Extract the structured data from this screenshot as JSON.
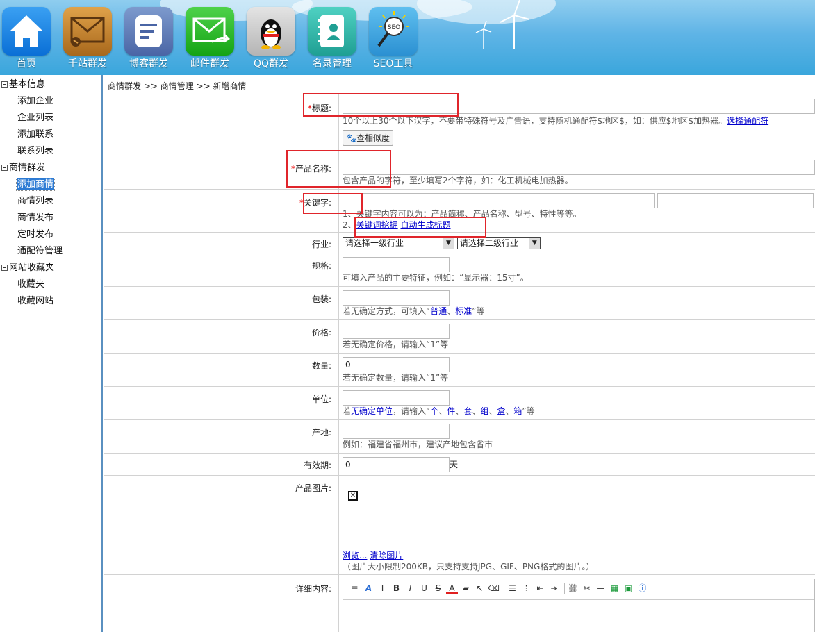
{
  "top_nav": [
    {
      "label": "首页",
      "icon": "home-icon"
    },
    {
      "label": "千站群发",
      "icon": "envelope-stack-icon"
    },
    {
      "label": "博客群发",
      "icon": "blog-doc-icon"
    },
    {
      "label": "邮件群发",
      "icon": "mail-send-icon"
    },
    {
      "label": "QQ群发",
      "icon": "qq-penguin-icon"
    },
    {
      "label": "名录管理",
      "icon": "contact-book-icon"
    },
    {
      "label": "SEO工具",
      "icon": "seo-magnifier-icon"
    }
  ],
  "sidebar": {
    "groups": [
      {
        "title": "基本信息",
        "items": [
          "添加企业",
          "企业列表",
          "添加联系",
          "联系列表"
        ]
      },
      {
        "title": "商情群发",
        "items": [
          "添加商情",
          "商情列表",
          "商情发布",
          "定时发布",
          "通配符管理"
        ]
      },
      {
        "title": "网站收藏夹",
        "items": [
          "收藏夹",
          "收藏网站"
        ]
      }
    ],
    "active": "添加商情"
  },
  "breadcrumb": "商情群发 >> 商情管理 >> 新增商情",
  "form": {
    "title": {
      "star": "*",
      "label": "标题:",
      "hint": "10个以上30个以下汉字，不要带特殊符号及广告语，支持随机通配符$地区$，如：供应$地区$加热器。",
      "link": "选择通配符",
      "button": "查相似度"
    },
    "product": {
      "star": "*",
      "label": "产品名称:",
      "hint": "包含产品的字符，至少填写2个字符，如：化工机械电加热器。"
    },
    "keyword": {
      "star": "*",
      "label": "关键字:",
      "hint1": "1、关键字内容可以为：产品简称、产品名称、型号、特性等等。",
      "hint2_prefix": "2、",
      "link1": "关键词挖掘",
      "link2": "自动生成标题"
    },
    "industry": {
      "label": "行业:",
      "select1": "请选择一级行业",
      "select2": "请选择二级行业"
    },
    "spec": {
      "label": "规格:",
      "hint": "可填入产品的主要特征，例如：“显示器：15寸”。"
    },
    "pack": {
      "label": "包装:",
      "hint_prefix": "若无确定方式，可填入“",
      "link1": "普通",
      "sep": "、",
      "link2": "标准",
      "hint_suffix": "”等"
    },
    "price": {
      "label": "价格:",
      "hint": "若无确定价格，请输入“1”等"
    },
    "qty": {
      "label": "数量:",
      "value": "0",
      "hint": "若无确定数量，请输入“1”等"
    },
    "unit": {
      "label": "单位:",
      "hint_prefix": "若",
      "link_main": "无确定单位",
      "hint_mid": "，请输入“",
      "units": [
        "个",
        "件",
        "套",
        "组",
        "盒",
        "箱"
      ],
      "hint_suffix": "”等"
    },
    "origin": {
      "label": "产地:",
      "hint": "例如：福建省福州市，建议产地包含省市"
    },
    "validity": {
      "label": "有效期:",
      "value": "0",
      "unit": "天"
    },
    "image": {
      "label": "产品图片:",
      "link_browse": "浏览...",
      "link_clear": "清除图片",
      "hint": "（图片大小限制200KB，只支持支持JPG、GIF、PNG格式的图片。）"
    },
    "detail": {
      "label": "详细内容:"
    }
  },
  "colors": {
    "highlight_box": "#e0252b",
    "active_item": "#2d7bd4",
    "required_star": "#e00"
  }
}
